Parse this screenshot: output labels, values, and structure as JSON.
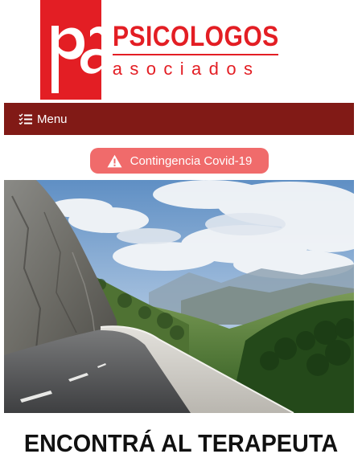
{
  "brand": {
    "title": "PSICOLOGOS",
    "subtitle": "asociados",
    "color": "#e31e24"
  },
  "menu": {
    "label": "Menu",
    "icon": "list-icon",
    "background": "#811a16"
  },
  "covid_button": {
    "label": "Contingencia Covid-19",
    "icon": "warning-icon",
    "background": "#f06b6b"
  },
  "hero": {
    "description_icon": "mountain-road-photo"
  },
  "heading": {
    "text": "ENCONTRÁ AL TERAPEUTA"
  }
}
